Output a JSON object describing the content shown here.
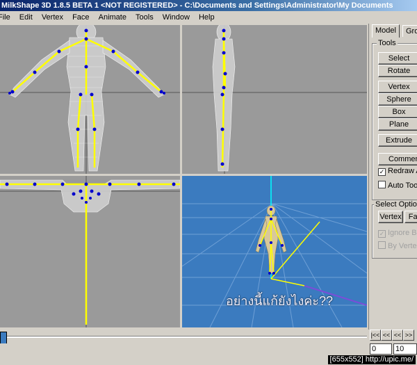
{
  "window": {
    "title": "MilkShape 3D 1.8.5 BETA 1 <NOT REGISTERED> - C:\\Documents and Settings\\Administrator\\My Documents"
  },
  "menu": {
    "items": [
      "File",
      "Edit",
      "Vertex",
      "Face",
      "Animate",
      "Tools",
      "Window",
      "Help"
    ]
  },
  "panel": {
    "tabs": [
      "Model",
      "Groups"
    ],
    "tools_label": "Tools",
    "tools": [
      "Select",
      "Rotate",
      "Vertex",
      "Sphere",
      "Box",
      "Plane",
      "Extrude",
      "Comment"
    ],
    "redraw_label": "Redraw All",
    "redraw_checked": true,
    "auto_label": "Auto Tool",
    "auto_checked": false,
    "select_options_label": "Select Options",
    "select_buttons": [
      "Vertex",
      "Face"
    ],
    "ignore_backfaces_label": "Ignore Backfaces",
    "ignore_backfaces_checked": true,
    "by_vertex_label": "By Vertex",
    "by_vertex_checked": false
  },
  "timeline": {
    "nav": [
      "|<<",
      "<<",
      "<<",
      ">>"
    ],
    "frame": "0",
    "total": "10"
  },
  "overlay": {
    "thai_text": "อย่างนี้แก้ยังไงค่ะ??"
  },
  "watermark": "[655x552] http://upic.me/",
  "colors": {
    "viewport_gray": "#9a9a9a",
    "viewport_blue": "#3b7bbf",
    "wire": "#f0f0f0",
    "bone": "#ffff00",
    "joint": "#0000cc"
  }
}
